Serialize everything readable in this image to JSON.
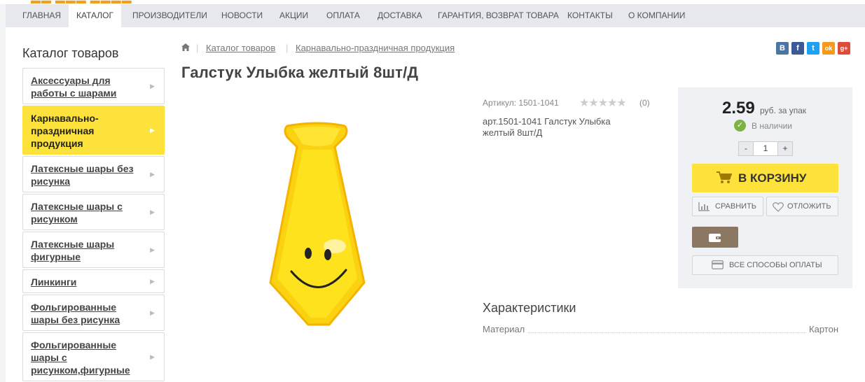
{
  "nav": {
    "items": [
      {
        "label": "ГЛАВНАЯ"
      },
      {
        "label": "КАТАЛОГ"
      },
      {
        "label": "ПРОИЗВОДИТЕЛИ"
      },
      {
        "label": "НОВОСТИ"
      },
      {
        "label": "АКЦИИ"
      },
      {
        "label": "ОПЛАТА"
      },
      {
        "label": "ДОСТАВКА"
      },
      {
        "label": "ГАРАНТИЯ, ВОЗВРАТ ТОВАРА"
      },
      {
        "label": "КОНТАКТЫ"
      },
      {
        "label": "О КОМПАНИИ"
      }
    ],
    "active": "КАТАЛОГ"
  },
  "sidebar": {
    "title": "Каталог товаров",
    "items": [
      {
        "label": "Аксессуары для работы с шарами"
      },
      {
        "label": "Карнавально-праздничная продукция"
      },
      {
        "label": "Латексные шары без рисунка"
      },
      {
        "label": "Латексные шары с рисунком"
      },
      {
        "label": "Латексные шары фигурные"
      },
      {
        "label": "Линкинги"
      },
      {
        "label": "Фольгированные шары без рисунка"
      },
      {
        "label": "Фольгированные шары с рисунком,фигурные"
      }
    ]
  },
  "breadcrumb": {
    "items": [
      {
        "label": "Каталог товаров"
      },
      {
        "label": "Карнавально-праздничная продукция"
      }
    ]
  },
  "share": {
    "icons": [
      {
        "name": "vk-icon",
        "glyph": "В",
        "color": "#4c75a3"
      },
      {
        "name": "facebook-icon",
        "glyph": "f",
        "color": "#3b5998"
      },
      {
        "name": "twitter-icon",
        "glyph": "t",
        "color": "#1da1f2"
      },
      {
        "name": "odnoklassniki-icon",
        "glyph": "ok",
        "color": "#f59a1e"
      },
      {
        "name": "googleplus-icon",
        "glyph": "g+",
        "color": "#dd4b39"
      }
    ]
  },
  "product": {
    "title": "Галстук Улыбка желтый 8шт/Д",
    "sku": "Артикул: 1501-1041",
    "rating_count": "(0)",
    "rating": 0,
    "description": "арт.1501-1041 Галстук Улыбка желтый 8шт/Д"
  },
  "buy": {
    "price": "2.59",
    "unit": "руб. за упак",
    "stock": "В наличии",
    "qty_minus": "-",
    "qty_value": "1",
    "qty_plus": "+",
    "cart_label": "В КОРЗИНУ",
    "compare_label": "СРАВНИТЬ",
    "defer_label": "ОТЛОЖИТЬ",
    "pay_label": "ВСЕ СПОСОБЫ ОПЛАТЫ"
  },
  "characteristics": {
    "title": "Характеристики",
    "rows": [
      {
        "name": "Материал",
        "value": "Картон"
      }
    ]
  },
  "colors": {
    "accent": "#fde23b",
    "wallet": "#8c7763",
    "stock": "#7cb342"
  }
}
